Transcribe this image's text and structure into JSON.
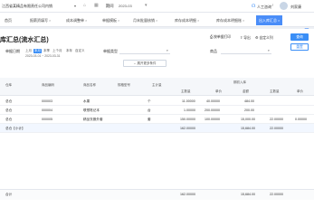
{
  "topbar": {
    "company": "江西省某精品有限责任公司内销",
    "company_caret": "▾",
    "period_label": "期间",
    "period_value": "2023-03",
    "help": "人工咨询",
    "user_name": "刘家康"
  },
  "tabs": [
    {
      "label": "首页",
      "close": ""
    },
    {
      "label": "报薪资填写",
      "close": "×"
    },
    {
      "label": "成本调整单",
      "close": "×"
    },
    {
      "label": "单据模板",
      "close": "×"
    },
    {
      "label": "月末批量核销",
      "close": "×"
    },
    {
      "label": "库存成本明细",
      "close": "×"
    },
    {
      "label": "库存成本明细账",
      "close": "×"
    },
    {
      "label": "出入库汇总",
      "close": "×"
    }
  ],
  "active_tab": 7,
  "page": {
    "title": "库汇总(流水汇总)",
    "actions": [
      "按单据打印",
      "导出",
      "自定义列"
    ],
    "query_button": "查询",
    "reset_button": "重置"
  },
  "filters": {
    "date_label": "单据日期",
    "date_chips": [
      "上月",
      "本月",
      "本季",
      "上个月",
      "本年",
      "自定义"
    ],
    "active_chip": 1,
    "date_range": "2023-03-01 ~ 2023-03-31",
    "doc_type_label": "单据类型",
    "goods_label": "商品",
    "expand_label": "展开更多条件"
  },
  "table": {
    "group_header": "期初入库",
    "headers": [
      "仓库",
      "商品编码",
      "商品名称",
      "规格型号",
      "主计量",
      "主数量",
      "单价",
      "金额",
      "主数量",
      "单价"
    ],
    "rows": [
      {
        "wh": "总仓",
        "code": "000003",
        "name": "水果",
        "spec": "",
        "unit": "个",
        "qty": "11.00000",
        "price": "40.00000",
        "amount": "484.00",
        "qty2": "",
        "price2": ""
      },
      {
        "wh": "总仓",
        "code": "000004",
        "name": "联想笔记本",
        "spec": "",
        "unit": "台",
        "qty": "1.00000",
        "price": "200.00000",
        "amount": "200.00",
        "qty2": "",
        "price2": ""
      },
      {
        "wh": "总仓",
        "code": "000005",
        "name": "精品衣服外套",
        "spec": "",
        "unit": "套",
        "qty": "150.00000",
        "price": "100.00000",
        "amount": "15,000.00",
        "qty2": "22.00000",
        "price2": "0.00000"
      }
    ],
    "subtotal": {
      "label": "总仓【小计】",
      "qty": "162.00000",
      "amount": "15,684.00",
      "qty2": "22.00000"
    },
    "footer": {
      "label": "合计",
      "qty": "162.00000",
      "amount": "15,684.00",
      "qty2": "22.00000"
    }
  }
}
